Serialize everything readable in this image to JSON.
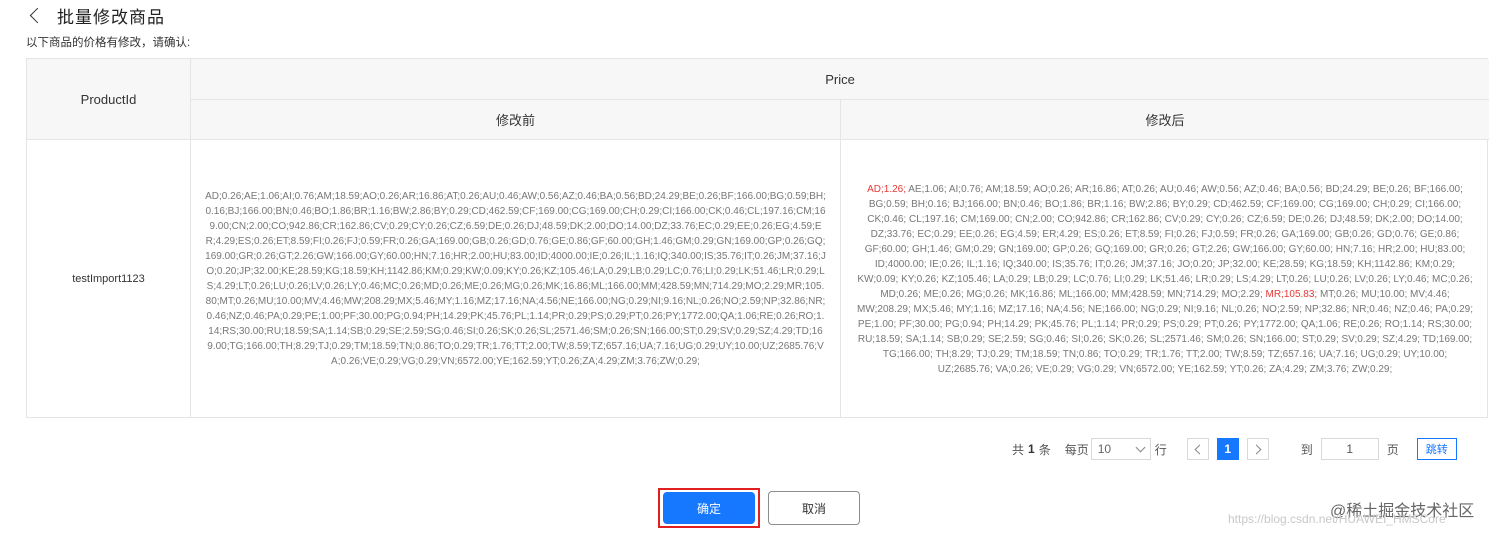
{
  "header": {
    "title": "批量修改商品",
    "subtitle": "以下商品的价格有修改，请确认:"
  },
  "table": {
    "col_product_id": "ProductId",
    "col_price": "Price",
    "col_before": "修改前",
    "col_after": "修改后",
    "rows": [
      {
        "product_id": "testImport1123",
        "before": "AD;0.26;AE;1.06;AI;0.76;AM;18.59;AO;0.26;AR;16.86;AT;0.26;AU;0.46;AW;0.56;AZ;0.46;BA;0.56;BD;24.29;BE;0.26;BF;166.00;BG;0.59;BH;0.16;BJ;166.00;BN;0.46;BO;1.86;BR;1.16;BW;2.86;BY;0.29;CD;462.59;CF;169.00;CG;169.00;CH;0.29;CI;166.00;CK;0.46;CL;197.16;CM;169.00;CN;2.00;CO;942.86;CR;162.86;CV;0.29;CY;0.26;CZ;6.59;DE;0.26;DJ;48.59;DK;2.00;DO;14.00;DZ;33.76;EC;0.29;EE;0.26;EG;4.59;ER;4.29;ES;0.26;ET;8.59;FI;0.26;FJ;0.59;FR;0.26;GA;169.00;GB;0.26;GD;0.76;GE;0.86;GF;60.00;GH;1.46;GM;0.29;GN;169.00;GP;0.26;GQ;169.00;GR;0.26;GT;2.26;GW;166.00;GY;60.00;HN;7.16;HR;2.00;HU;83.00;ID;4000.00;IE;0.26;IL;1.16;IQ;340.00;IS;35.76;IT;0.26;JM;37.16;JO;0.20;JP;32.00;KE;28.59;KG;18.59;KH;1142.86;KM;0.29;KW;0.09;KY;0.26;KZ;105.46;LA;0.29;LB;0.29;LC;0.76;LI;0.29;LK;51.46;LR;0.29;LS;4.29;LT;0.26;LU;0.26;LV;0.26;LY;0.46;MC;0.26;MD;0.26;ME;0.26;MG;0.26;MK;16.86;ML;166.00;MM;428.59;MN;714.29;MO;2.29;MR;105.80;MT;0.26;MU;10.00;MV;4.46;MW;208.29;MX;5.46;MY;1.16;MZ;17.16;NA;4.56;NE;166.00;NG;0.29;NI;9.16;NL;0.26;NO;2.59;NP;32.86;NR;0.46;NZ;0.46;PA;0.29;PE;1.00;PF;30.00;PG;0.94;PH;14.29;PK;45.76;PL;1.14;PR;0.29;PS;0.29;PT;0.26;PY;1772.00;QA;1.06;RE;0.26;RO;1.14;RS;30.00;RU;18.59;SA;1.14;SB;0.29;SE;2.59;SG;0.46;SI;0.26;SK;0.26;SL;2571.46;SM;0.26;SN;166.00;ST;0.29;SV;0.29;SZ;4.29;TD;169.00;TG;166.00;TH;8.29;TJ;0.29;TM;18.59;TN;0.86;TO;0.29;TR;1.76;TT;2.00;TW;8.59;TZ;657.16;UA;7.16;UG;0.29;UY;10.00;UZ;2685.76;VA;0.26;VE;0.29;VG;0.29;VN;6572.00;YE;162.59;YT;0.26;ZA;4.29;ZM;3.76;ZW;0.29;",
        "after_changed_1": "AD;1.26;",
        "after_part_1": " AE;1.06; AI;0.76; AM;18.59; AO;0.26; AR;16.86; AT;0.26; AU;0.46; AW;0.56; AZ;0.46; BA;0.56; BD;24.29; BE;0.26; BF;166.00; BG;0.59; BH;0.16; BJ;166.00; BN;0.46; BO;1.86; BR;1.16; BW;2.86; BY;0.29; CD;462.59; CF;169.00; CG;169.00; CH;0.29; CI;166.00; CK;0.46; CL;197.16; CM;169.00; CN;2.00; CO;942.86; CR;162.86; CV;0.29; CY;0.26; CZ;6.59; DE;0.26; DJ;48.59; DK;2.00; DO;14.00; DZ;33.76; EC;0.29; EE;0.26; EG;4.59; ER;4.29; ES;0.26; ET;8.59; FI;0.26; FJ;0.59; FR;0.26; GA;169.00; GB;0.26; GD;0.76; GE;0.86; GF;60.00; GH;1.46; GM;0.29; GN;169.00; GP;0.26; GQ;169.00; GR;0.26; GT;2.26; GW;166.00; GY;60.00; HN;7.16; HR;2.00; HU;83.00; ID;4000.00; IE;0.26; IL;1.16; IQ;340.00; IS;35.76; IT;0.26; JM;37.16; JO;0.20; JP;32.00; KE;28.59; KG;18.59; KH;1142.86; KM;0.29; KW;0.09; KY;0.26; KZ;105.46; LA;0.29; LB;0.29; LC;0.76; LI;0.29; LK;51.46; LR;0.29; LS;4.29; LT;0.26; LU;0.26; LV;0.26; LY;0.46; MC;0.26; MD;0.26; ME;0.26; MG;0.26; MK;16.86; ML;166.00; MM;428.59; MN;714.29; MO;2.29; ",
        "after_changed_2": "MR;105.83;",
        "after_part_2": " MT;0.26; MU;10.00; MV;4.46; MW;208.29; MX;5.46; MY;1.16; MZ;17.16; NA;4.56; NE;166.00; NG;0.29; NI;9.16; NL;0.26; NO;2.59; NP;32.86; NR;0.46; NZ;0.46; PA;0.29; PE;1.00; PF;30.00; PG;0.94; PH;14.29; PK;45.76; PL;1.14; PR;0.29; PS;0.29; PT;0.26; PY;1772.00; QA;1.06; RE;0.26; RO;1.14; RS;30.00; RU;18.59; SA;1.14; SB;0.29; SE;2.59; SG;0.46; SI;0.26; SK;0.26; SL;2571.46; SM;0.26; SN;166.00; ST;0.29; SV;0.29; SZ;4.29; TD;169.00; TG;166.00; TH;8.29; TJ;0.29; TM;18.59; TN;0.86; TO;0.29; TR;1.76; TT;2.00; TW;8.59; TZ;657.16; UA;7.16; UG;0.29; UY;10.00; UZ;2685.76; VA;0.26; VE;0.29; VG;0.29; VN;6572.00; YE;162.59; YT;0.26; ZA;4.29; ZM;3.76; ZW;0.29;"
      }
    ]
  },
  "pagination": {
    "total_prefix": "共",
    "total_count": "1",
    "total_suffix": "条",
    "per_page_label": "每页",
    "page_size": "10",
    "per_page_unit": "行",
    "current_page": "1",
    "goto_label": "到",
    "goto_value": "1",
    "goto_unit": "页",
    "jump_label": "跳转"
  },
  "actions": {
    "confirm_label": "确定",
    "cancel_label": "取消"
  },
  "watermark": {
    "site": "@稀土掘金技术社区",
    "url": "https://blog.csdn.net/HUAWEI_HMSCore"
  },
  "colors": {
    "primary": "#1677ff",
    "changed_value": "#e53935",
    "highlight_border": "#e02020"
  }
}
